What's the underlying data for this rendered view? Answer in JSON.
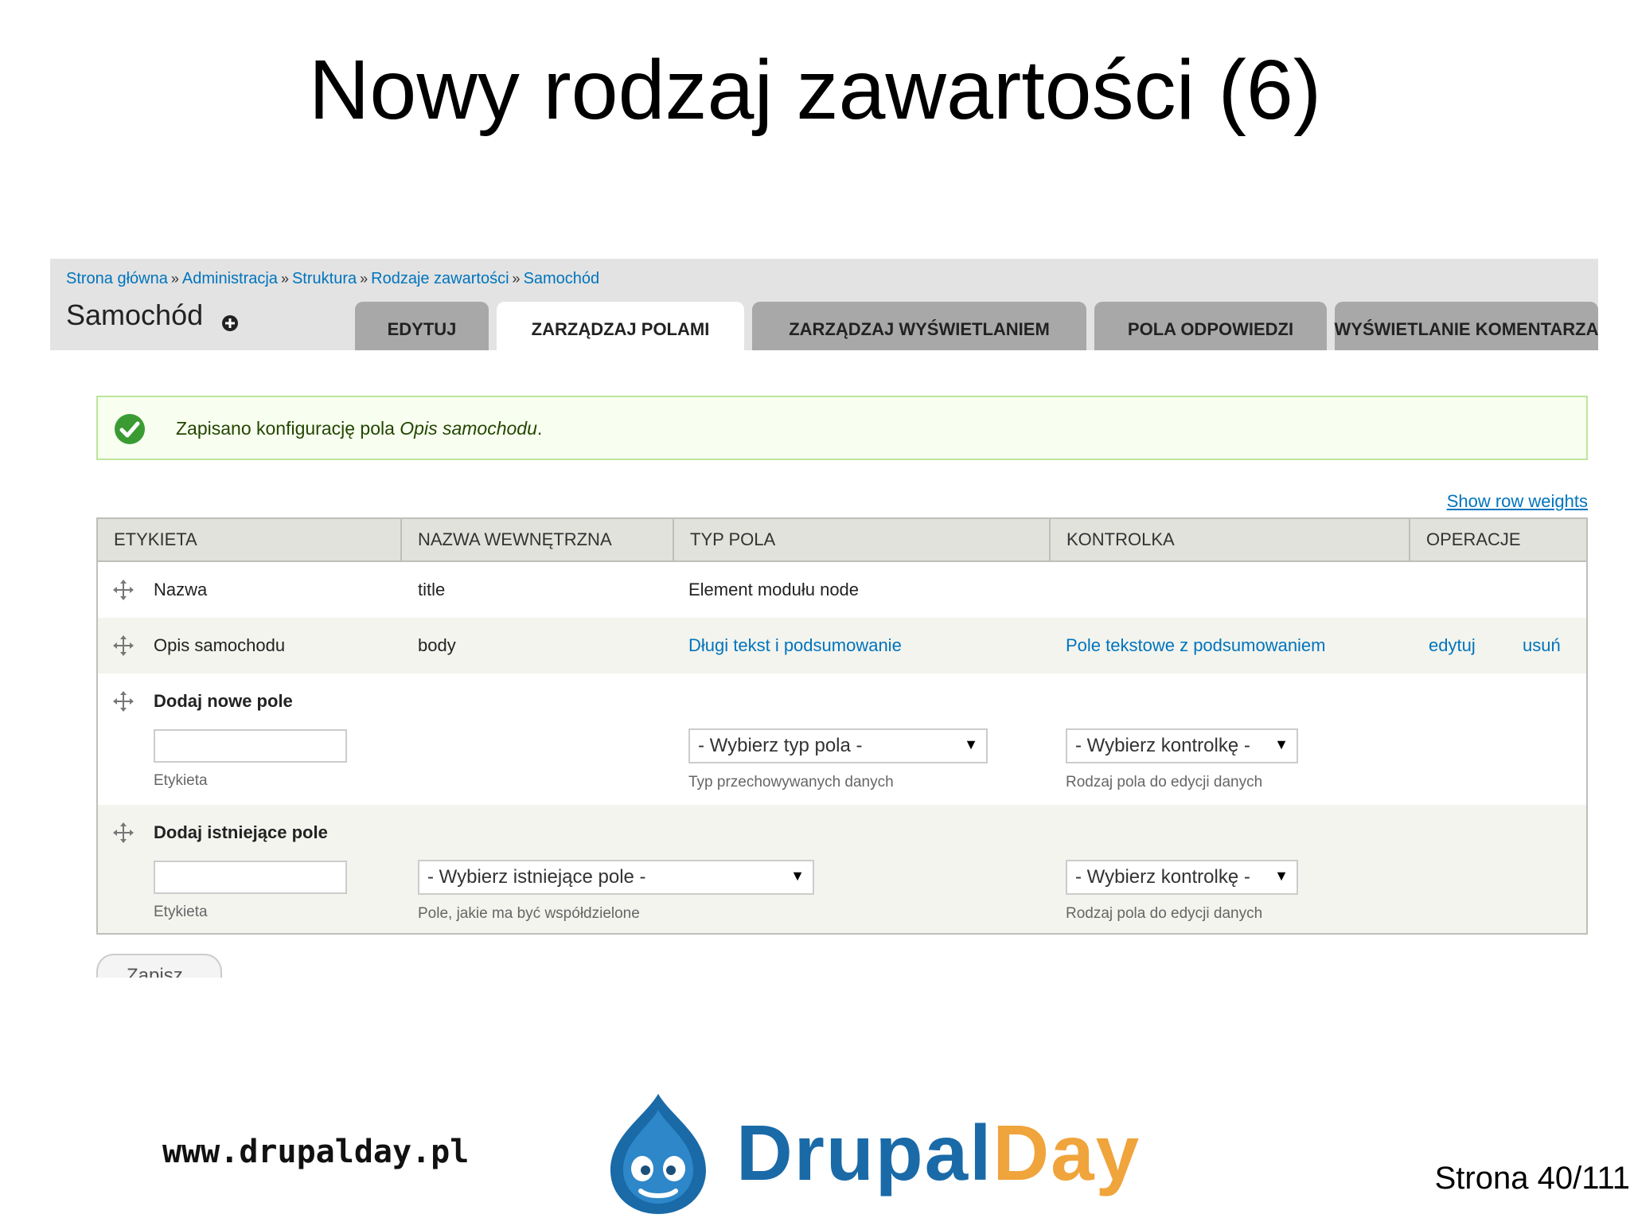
{
  "slide": {
    "title": "Nowy rodzaj zawartości (6)",
    "site_url": "www.drupalday.pl",
    "logo_text_1": "Drupal",
    "logo_text_2": "Day",
    "page_number": "Strona 40/111"
  },
  "breadcrumb": {
    "items": [
      "Strona główna",
      "Administracja",
      "Struktura",
      "Rodzaje zawartości",
      "Samochód"
    ],
    "separator": "»"
  },
  "page": {
    "title": "Samochód"
  },
  "tabs": [
    {
      "label": "EDYTUJ",
      "active": false
    },
    {
      "label": "ZARZĄDZAJ POLAMI",
      "active": true
    },
    {
      "label": "ZARZĄDZAJ WYŚWIETLANIEM",
      "active": false
    },
    {
      "label": "POLA ODPOWIEDZI",
      "active": false
    },
    {
      "label": "WYŚWIETLANIE KOMENTARZA",
      "active": false
    }
  ],
  "status": {
    "text_prefix": "Zapisano konfigurację pola ",
    "field_name": "Opis samochodu",
    "text_suffix": "."
  },
  "row_weights_link": "Show row weights",
  "table": {
    "headers": [
      "ETYKIETA",
      "NAZWA WEWNĘTRZNA",
      "TYP POLA",
      "KONTROLKA",
      "OPERACJE"
    ],
    "rows": [
      {
        "label": "Nazwa",
        "machine_name": "title",
        "type": "Element modułu node"
      },
      {
        "label": "Opis samochodu",
        "machine_name": "body",
        "type": "Długi tekst i podsumowanie",
        "widget": "Pole tekstowe z podsumowaniem",
        "op_edit": "edytuj",
        "op_delete": "usuń"
      }
    ],
    "add_new": {
      "title": "Dodaj nowe pole",
      "label_desc": "Etykieta",
      "type_select": "- Wybierz typ pola -",
      "type_desc": "Typ przechowywanych danych",
      "widget_select": "- Wybierz kontrolkę -",
      "widget_desc": "Rodzaj pola do edycji danych"
    },
    "add_existing": {
      "title": "Dodaj istniejące pole",
      "label_desc": "Etykieta",
      "field_select": "- Wybierz istniejące pole -",
      "field_desc": "Pole, jakie ma być współdzielone",
      "widget_select": "- Wybierz kontrolkę -",
      "widget_desc": "Rodzaj pola do edycji danych"
    }
  },
  "save_button": "Zapisz",
  "colors": {
    "link": "#0074bd",
    "tab_inactive": "#a8a8a8",
    "status_bg": "#f8fff0",
    "status_border": "#bde59a",
    "check_green": "#3a9b33",
    "drupal_blue": "#1a6aa8",
    "drupal_orange": "#f0a43c"
  }
}
